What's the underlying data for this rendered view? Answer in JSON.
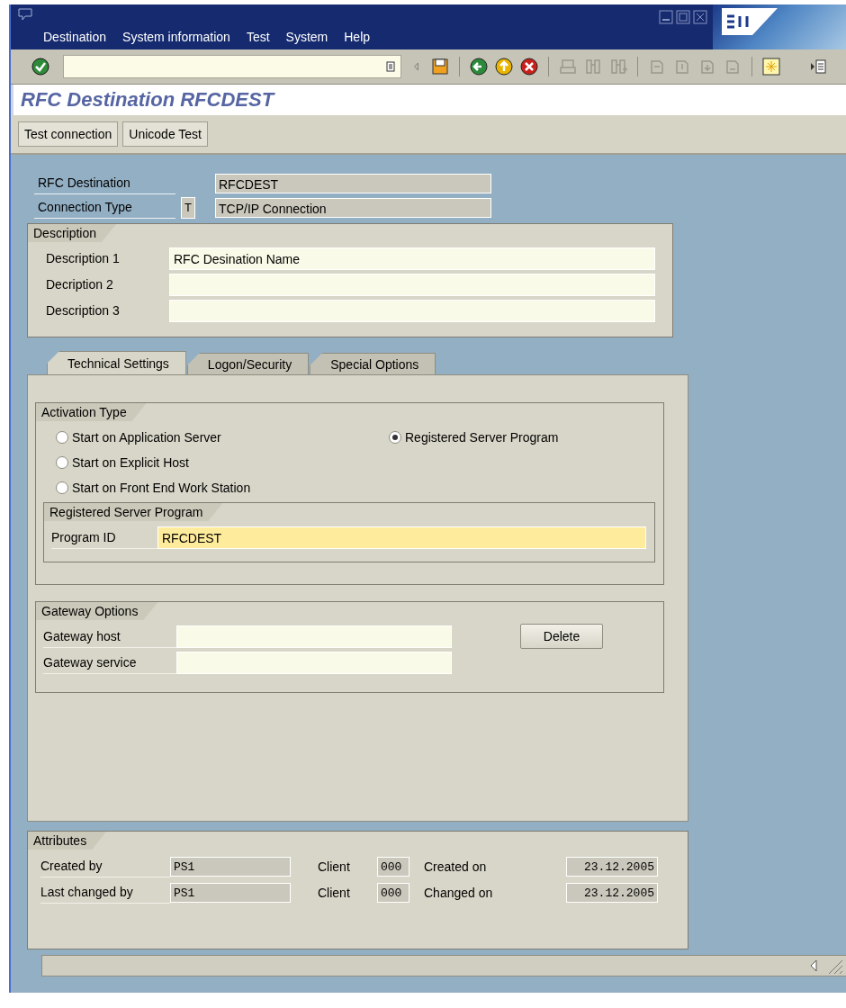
{
  "menu": [
    {
      "label": "Destination"
    },
    {
      "label": "System information"
    },
    {
      "label": "Test"
    },
    {
      "label": "System"
    },
    {
      "label": "Help"
    }
  ],
  "title": "RFC Destination RFCDEST",
  "app_buttons": [
    "Test connection",
    "Unicode Test"
  ],
  "header_fields": [
    {
      "label": "RFC Destination",
      "value": "RFCDEST"
    },
    {
      "label": "Connection Type",
      "code": "T",
      "value": "TCP/IP Connection"
    }
  ],
  "description": {
    "title": "Description",
    "fields": [
      {
        "label": "Description 1",
        "value": "RFC Desination Name"
      },
      {
        "label": "Decription 2"
      },
      {
        "label": "Description 3"
      }
    ]
  },
  "tabs": [
    {
      "label": "Technical Settings",
      "selected": true
    },
    {
      "label": "Logon/Security",
      "selected": false
    },
    {
      "label": "Special Options",
      "selected": false
    }
  ],
  "activation_type": {
    "title": "Activation Type",
    "options": [
      {
        "label": "Start on Application Server",
        "selected": false
      },
      {
        "label": "Start on Explicit Host",
        "selected": false
      },
      {
        "label": "Start on Front End Work Station",
        "selected": false
      },
      {
        "label": "Registered Server Program",
        "selected": true
      }
    ]
  },
  "registered_server_program": {
    "title": "Registered Server Program",
    "fields": [
      {
        "label": "Program ID",
        "value": "RFCDEST"
      }
    ]
  },
  "gateway_options": {
    "title": "Gateway Options",
    "fields": [
      {
        "label": "Gateway host"
      },
      {
        "label": "Gateway service"
      }
    ],
    "button": "Delete"
  },
  "attributes": {
    "title": "Attributes",
    "rows": [
      {
        "label": "Created by",
        "user": "PS1",
        "client_label": "Client",
        "client": "000",
        "date_label": "Created on",
        "date": "23.12.2005"
      },
      {
        "label": "Last changed by",
        "user": "PS1",
        "client_label": "Client",
        "client": "000",
        "date_label": "Changed on",
        "date": "23.12.2005"
      }
    ]
  }
}
